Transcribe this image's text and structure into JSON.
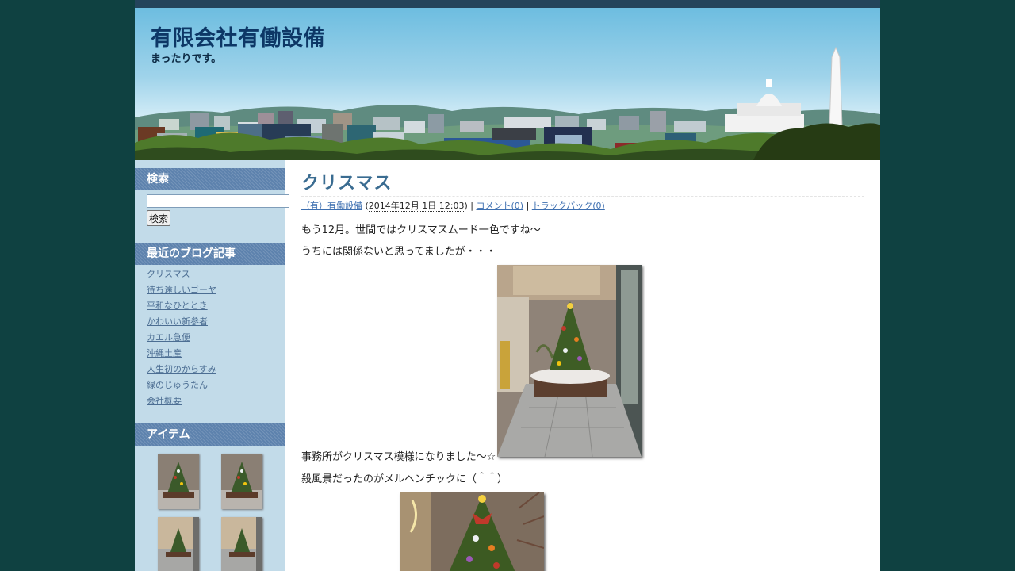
{
  "site": {
    "title": "有限会社有働設備",
    "description": "まったりです。"
  },
  "sidebar": {
    "search": {
      "heading": "検索",
      "input_value": "",
      "button_label": "検索"
    },
    "recent": {
      "heading": "最近のブログ記事",
      "items": [
        "クリスマス",
        "待ち遠しいゴーヤ",
        "平和なひととき",
        "かわいい新参者",
        "カエル急便",
        "沖縄土産",
        "人生初のからすみ",
        "緑のじゅうたん",
        "会社概要"
      ]
    },
    "items": {
      "heading": "アイテム"
    }
  },
  "post": {
    "title": "クリスマス",
    "meta": {
      "author": "（有）有働設備",
      "date": "2014年12月 1日 12:03",
      "comments": "コメント(0)",
      "trackbacks": "トラックバック(0)"
    },
    "paragraphs": [
      "もう12月。世間ではクリスマスムード一色ですね～",
      "うちには関係ないと思ってましたが・・・",
      "事務所がクリスマス模様になりました～☆",
      "殺風景だったのがメルヘンチックに（＾＾）"
    ]
  },
  "colors": {
    "page_background": "#0f4141",
    "header_title": "#0d3766",
    "sidebar_background": "#c2dbe9",
    "sidebar_heading": "#5d82ad",
    "post_title": "#3a6c91",
    "link": "#3d6fb0"
  }
}
